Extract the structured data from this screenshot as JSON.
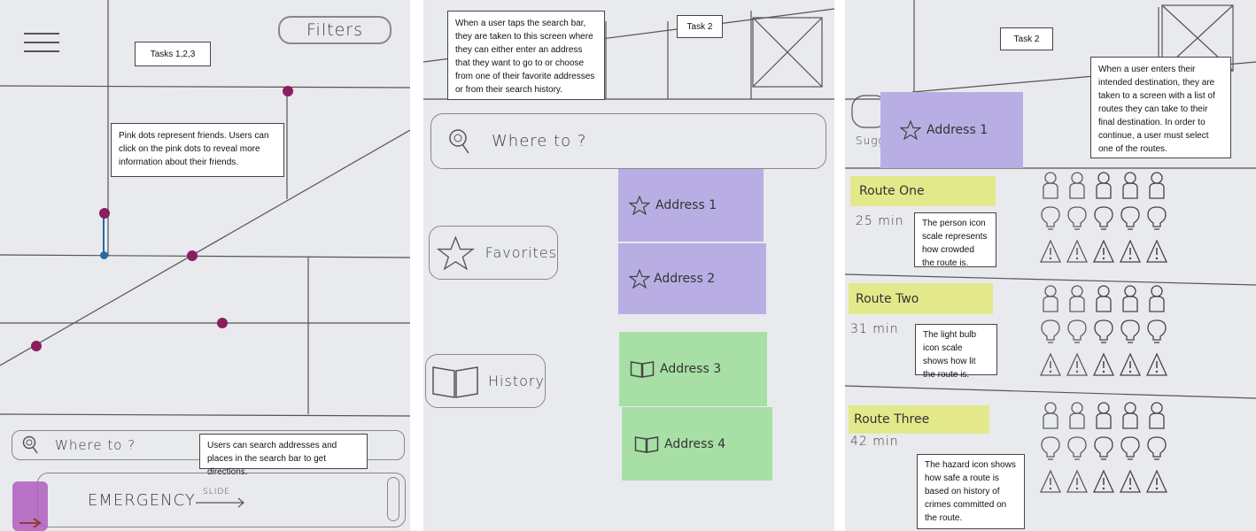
{
  "panel1": {
    "filters_label": "Filters",
    "tasks_tag": "Tasks 1,2,3",
    "friends_note": "Pink dots represent friends. Users can click on the pink dots to reveal more information about their friends.",
    "search_text": "Where to ?",
    "search_note": "Users can search addresses and places in the search bar to get directions.",
    "emergency_label": "EMERGENCY",
    "slide_label": "SLIDE"
  },
  "panel2": {
    "note": "When a user taps the search bar, they are taken to this screen where they can either enter an address that they want to go to or choose from one of their favorite addresses or from their search history.",
    "task_tag": "Task 2",
    "search_text": "Where to ?",
    "favorites_label": "Favorites",
    "history_label": "History",
    "addresses": [
      "Address 1",
      "Address 2",
      "Address 3",
      "Address 4"
    ]
  },
  "panel3": {
    "task_tag": "Task 2",
    "note": "When a user enters their intended destination, they are taken to a screen with a list of routes they can take to their final destination. In order to continue, a user must select one of the routes.",
    "selected_address": "Address 1",
    "sugg_text": "Sugg",
    "routes": [
      {
        "name": "Route One",
        "time": "25 min"
      },
      {
        "name": "Route Two",
        "time": "31 min"
      },
      {
        "name": "Route Three",
        "time": "42 min"
      }
    ],
    "person_note": "The person icon scale represents how crowded the route is.",
    "bulb_note": "The light bulb icon scale shows how lit the route is.",
    "hazard_note": "The hazard icon shows how safe a route is based on history of crimes committed on the route."
  },
  "colors": {
    "paper": "#e9eaee",
    "friend_dot": "#8a1e5e",
    "user_dot": "#1f6ca6",
    "sticky_purple": "#b9aee4",
    "sticky_green": "#a8dfa5",
    "sticky_yellow": "#e3e98b",
    "emergency_purple": "#b05fc0"
  },
  "icons": [
    "menu-icon",
    "search-icon",
    "star-icon",
    "book-icon",
    "person-icon",
    "bulb-icon",
    "hazard-icon",
    "arrow-icon"
  ]
}
